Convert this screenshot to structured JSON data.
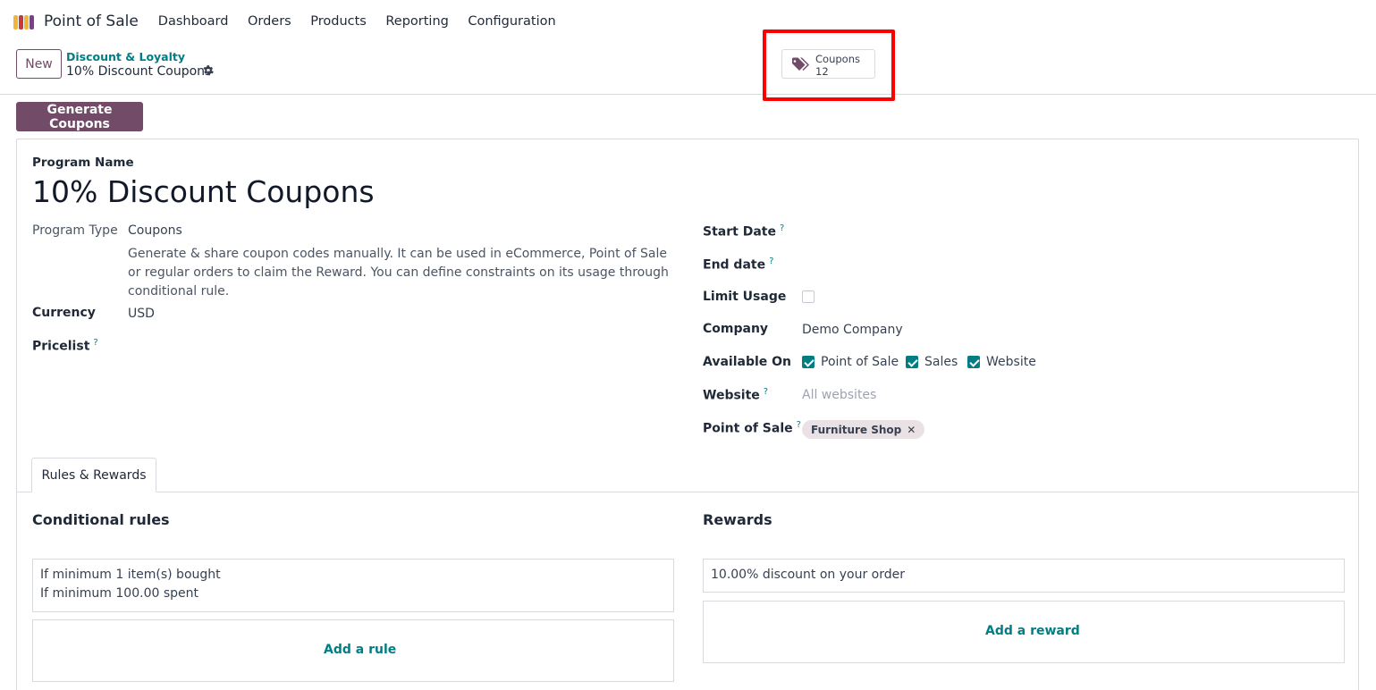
{
  "nav": {
    "app_name": "Point of Sale",
    "items": [
      "Dashboard",
      "Orders",
      "Products",
      "Reporting",
      "Configuration"
    ]
  },
  "control": {
    "new_label": "New",
    "breadcrumb_parent": "Discount & Loyalty",
    "breadcrumb_current": "10% Discount Coupons",
    "smart_button": {
      "label": "Coupons",
      "count": "12"
    }
  },
  "actions": {
    "generate_label": "Generate Coupons"
  },
  "form": {
    "program_name_label": "Program Name",
    "program_name": "10% Discount Coupons",
    "program_type_label": "Program Type",
    "program_type": "Coupons",
    "program_type_desc": "Generate & share coupon codes manually. It can be used in eCommerce, Point of Sale or regular orders to claim the Reward. You can define constraints on its usage through conditional rule.",
    "currency_label": "Currency",
    "currency": "USD",
    "pricelist_label": "Pricelist",
    "start_date_label": "Start Date",
    "end_date_label": "End date",
    "limit_usage_label": "Limit Usage",
    "limit_usage": false,
    "company_label": "Company",
    "company": "Demo Company",
    "available_on_label": "Available On",
    "available_on": [
      {
        "label": "Point of Sale",
        "checked": true
      },
      {
        "label": "Sales",
        "checked": true
      },
      {
        "label": "Website",
        "checked": true
      }
    ],
    "website_label": "Website",
    "website_placeholder": "All websites",
    "pos_label": "Point of Sale",
    "pos_tag": "Furniture Shop",
    "help_mark": "?"
  },
  "tabs": {
    "rules_rewards": "Rules & Rewards"
  },
  "rules": {
    "title": "Conditional rules",
    "lines": [
      "If minimum 1 item(s) bought",
      "If minimum 100.00 spent"
    ],
    "add_label": "Add a rule"
  },
  "rewards": {
    "title": "Rewards",
    "lines": [
      "10.00% discount on your order"
    ],
    "add_label": "Add a reward"
  },
  "colors": {
    "brand": "#714B67",
    "accent": "#017e84",
    "highlight": "#ff0000"
  }
}
